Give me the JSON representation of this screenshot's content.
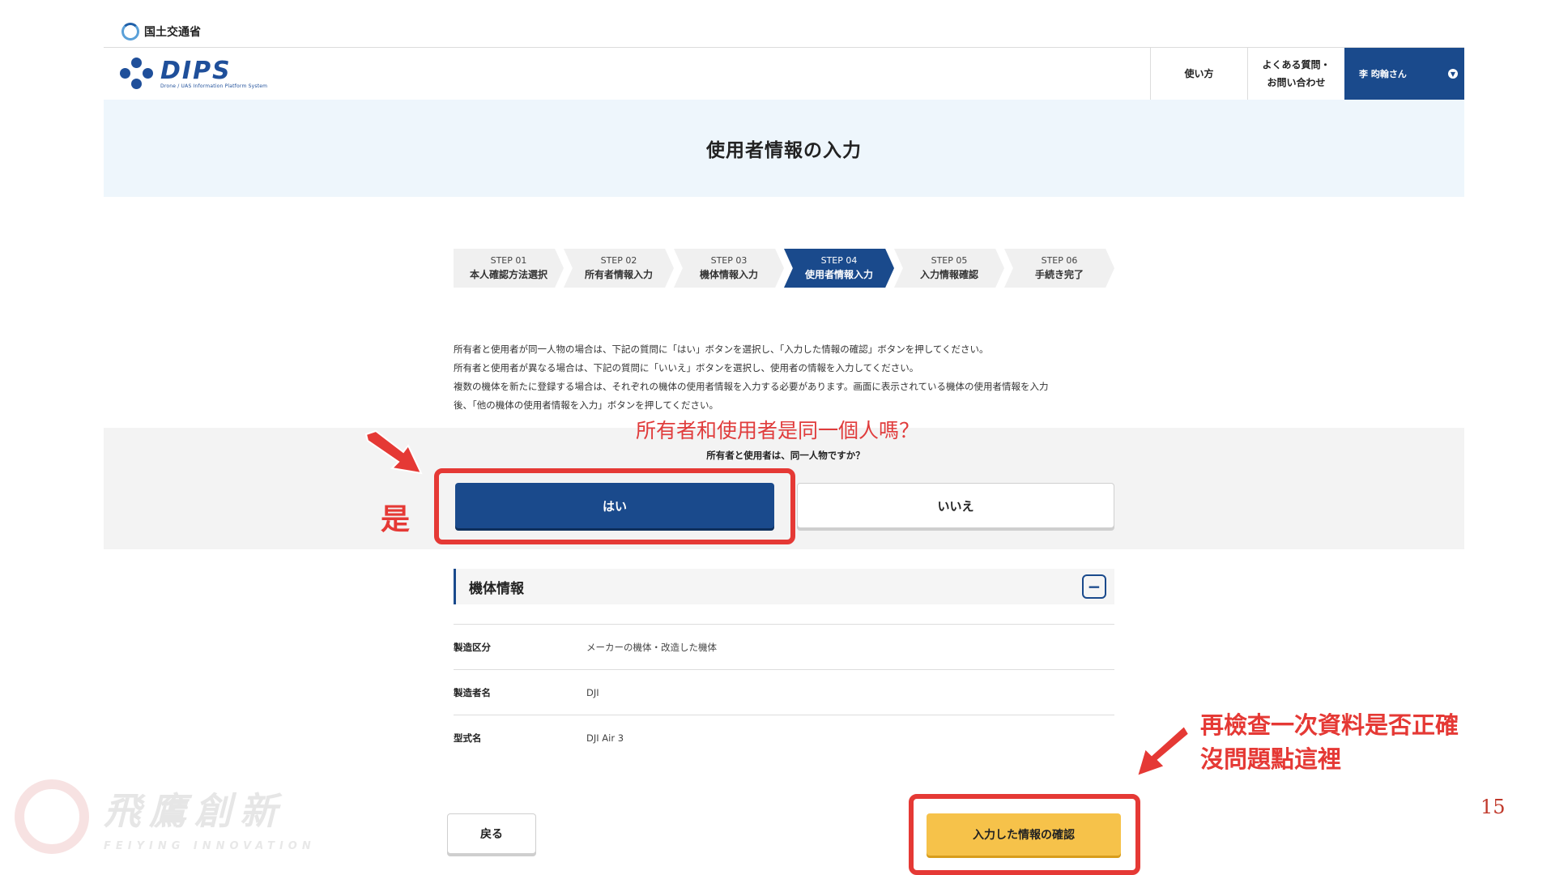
{
  "ministry": {
    "name": "国土交通省"
  },
  "logo": {
    "word": "DIPS",
    "subtitle": "Drone / UAS Information Platform System"
  },
  "nav": {
    "usage": "使い方",
    "faq_line1": "よくある質問・",
    "faq_line2": "お問い合わせ",
    "user": "李 昀翰さん"
  },
  "page": {
    "title": "使用者情報の入力"
  },
  "steps": [
    {
      "num": "STEP 01",
      "label": "本人確認方法選択"
    },
    {
      "num": "STEP 02",
      "label": "所有者情報入力"
    },
    {
      "num": "STEP 03",
      "label": "機体情報入力"
    },
    {
      "num": "STEP 04",
      "label": "使用者情報入力"
    },
    {
      "num": "STEP 05",
      "label": "入力情報確認"
    },
    {
      "num": "STEP 06",
      "label": "手続き完了"
    }
  ],
  "active_step": 4,
  "instructions": [
    "所有者と使用者が同一人物の場合は、下記の質問に「はい」ボタンを選択し、「入力した情報の確認」ボタンを押してください。",
    "所有者と使用者が異なる場合は、下記の質問に「いいえ」ボタンを選択し、使用者の情報を入力してください。",
    "複数の機体を新たに登録する場合は、それぞれの機体の使用者情報を入力する必要があります。画面に表示されている機体の使用者情報を入力",
    "後、「他の機体の使用者情報を入力」ボタンを押してください。"
  ],
  "question": {
    "annotation": "所有者和使用者是同一個人嗎？",
    "text": "所有者と使用者は、同一人物ですか？",
    "yes_label": "はい",
    "no_label": "いいえ",
    "yes_annotation": "是"
  },
  "airframe": {
    "title": "機体情報",
    "rows": [
      {
        "key": "製造区分",
        "value": "メーカーの機体・改造した機体"
      },
      {
        "key": "製造者名",
        "value": "DJI"
      },
      {
        "key": "型式名",
        "value": "DJI Air 3"
      }
    ]
  },
  "actions": {
    "back_label": "戻る",
    "confirm_label": "入力した情報の確認",
    "annotation_line1": "再檢查一次資料是否正確",
    "annotation_line2": "沒問題點這裡"
  },
  "page_number": "15",
  "watermark": {
    "cn": "飛鷹創新",
    "en": "FEIYING INNOVATION"
  },
  "colors": {
    "brand": "#1a4a8c",
    "confirm": "#f6c24a",
    "annotation": "#e53935"
  }
}
